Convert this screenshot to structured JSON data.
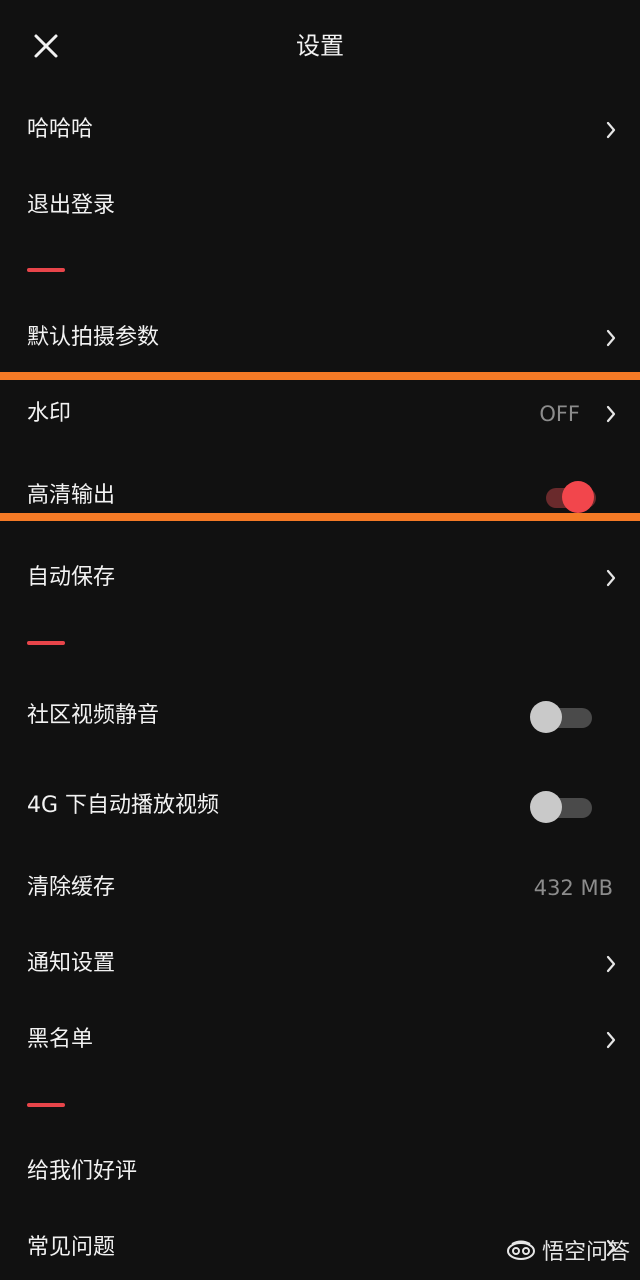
{
  "header": {
    "title": "设置"
  },
  "rows": [
    {
      "label": "哈哈哈"
    },
    {
      "label": "退出登录"
    },
    {
      "label": "默认拍摄参数"
    },
    {
      "label": "水印",
      "value": "OFF"
    },
    {
      "label": "高清输出",
      "toggle": "on"
    },
    {
      "label": "自动保存"
    },
    {
      "label": "社区视频静音",
      "toggle": "off"
    },
    {
      "label": "4G 下自动播放视频",
      "toggle": "off"
    },
    {
      "label": "清除缓存",
      "value": "432 MB"
    },
    {
      "label": "通知设置"
    },
    {
      "label": "黑名单"
    },
    {
      "label": "给我们好评"
    },
    {
      "label": "常见问题"
    }
  ],
  "colors": {
    "background": "#111111",
    "accent": "#f2464c",
    "divider": "#e8454a",
    "highlight": "#f47a26",
    "secondary_text": "#8c8c8c"
  },
  "watermark": {
    "text": "悟空问答",
    "icon": "wukong-logo-icon"
  }
}
